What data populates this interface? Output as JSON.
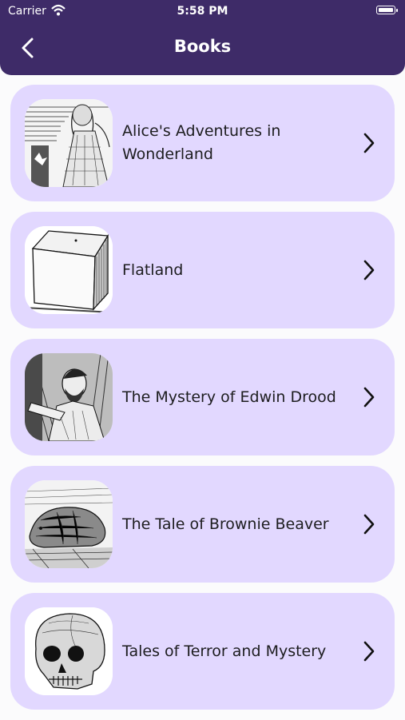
{
  "status_bar": {
    "carrier": "Carrier",
    "time": "5:58 PM"
  },
  "header": {
    "title": "Books"
  },
  "books": [
    {
      "title": "Alice's Adventures in Wonderland",
      "thumb_icon": "alice-illustration"
    },
    {
      "title": "Flatland",
      "thumb_icon": "cube-illustration"
    },
    {
      "title": "The Mystery of Edwin Drood",
      "thumb_icon": "man-portrait-illustration"
    },
    {
      "title": "The Tale of Brownie Beaver",
      "thumb_icon": "beaver-illustration"
    },
    {
      "title": "Tales of Terror and Mystery",
      "thumb_icon": "skull-illustration"
    }
  ],
  "colors": {
    "header": "#3e2b68",
    "card": "#e2d8ff",
    "background": "#fbfbfc"
  }
}
